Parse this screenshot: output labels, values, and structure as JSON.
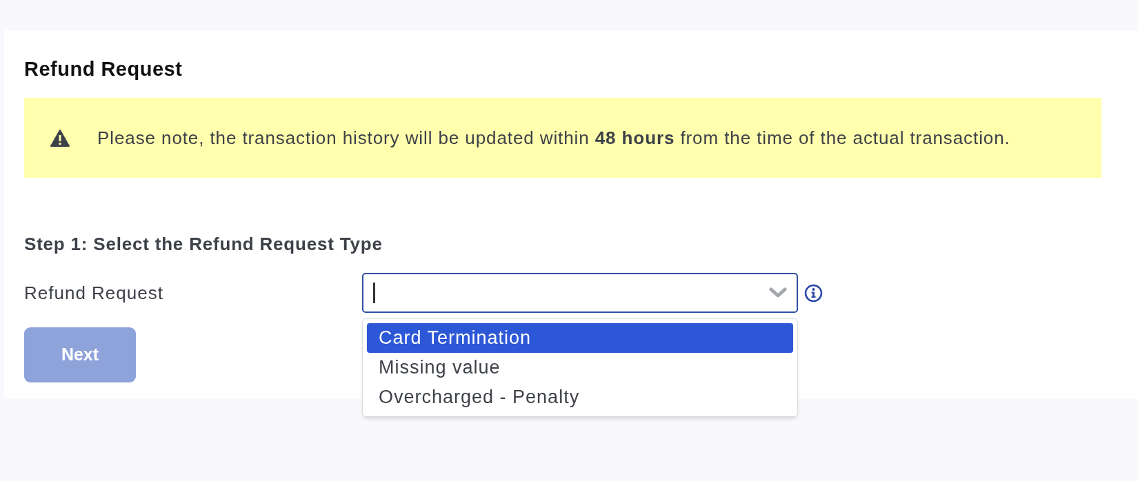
{
  "title": "Refund Request",
  "notice": {
    "text": "Please note, the transaction history will be updated within **48 hours** from the time of the actual transaction."
  },
  "step": {
    "heading": "Step 1: Select the Refund Request Type",
    "label": "Refund Request",
    "dropdown": {
      "expanded": true,
      "options": [
        {
          "label": "Card Termination",
          "selected": true
        },
        {
          "label": "Missing value",
          "selected": false
        },
        {
          "label": "Overcharged - Penalty",
          "selected": false
        }
      ]
    }
  },
  "next_button": {
    "label": "Next",
    "disabled": true
  }
}
